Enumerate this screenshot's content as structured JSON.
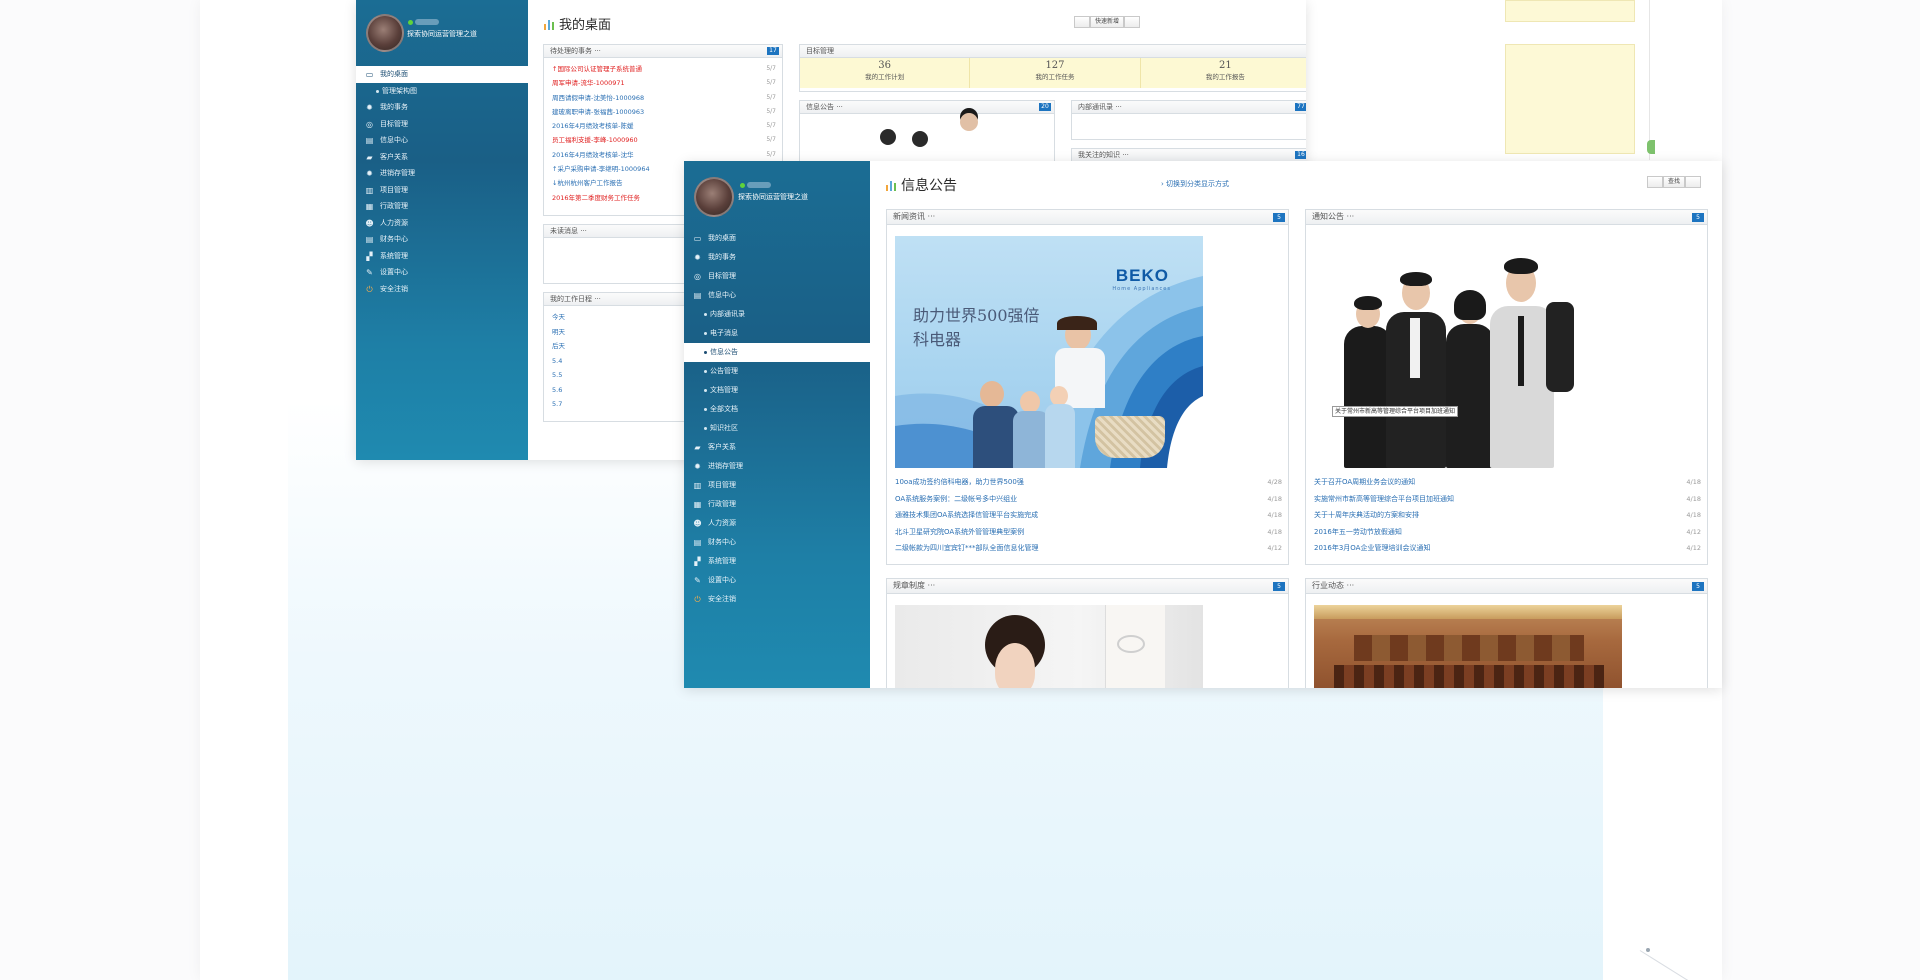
{
  "back_window": {
    "company": "探索协同运营管理之道",
    "title": "我的桌面",
    "buttons": [
      "",
      "快速新增",
      ""
    ],
    "nav": [
      {
        "label": "我的桌面",
        "icon": "monitor-icon",
        "glyph": "▭",
        "active": true
      },
      {
        "label": "管理架构图",
        "sub": true
      },
      {
        "label": "我的事务",
        "icon": "gear-icon",
        "glyph": "✹"
      },
      {
        "label": "目标管理",
        "icon": "target-icon",
        "glyph": "◎"
      },
      {
        "label": "信息中心",
        "icon": "info-icon",
        "glyph": "▤"
      },
      {
        "label": "客户关系",
        "icon": "folder-icon",
        "glyph": "▰"
      },
      {
        "label": "进销存管理",
        "icon": "gear-icon",
        "glyph": "✹"
      },
      {
        "label": "项目管理",
        "icon": "project-icon",
        "glyph": "▥"
      },
      {
        "label": "行政管理",
        "icon": "admin-icon",
        "glyph": "▦"
      },
      {
        "label": "人力资源",
        "icon": "people-icon",
        "glyph": "☻"
      },
      {
        "label": "财务中心",
        "icon": "finance-icon",
        "glyph": "▤"
      },
      {
        "label": "系统管理",
        "icon": "system-icon",
        "glyph": "▞"
      },
      {
        "label": "设置中心",
        "icon": "wrench-icon",
        "glyph": "✎"
      },
      {
        "label": "安全注销",
        "icon": "power-icon",
        "glyph": "⏻"
      }
    ],
    "todo": {
      "header": "待处理的事务 ···",
      "count": "17",
      "items": [
        {
          "text": "↑国际公司认证管理子系统普通",
          "red": true,
          "date": "5/7"
        },
        {
          "text": "周军申请-流华-1000971",
          "red": true,
          "date": "5/7"
        },
        {
          "text": "周西请假申请-沈美怡-1000968",
          "red": false,
          "date": "5/7"
        },
        {
          "text": "建玻离职申请-张福茜-1000963",
          "red": false,
          "date": "5/7"
        },
        {
          "text": "2016年4月绩效考核单-陈媛",
          "red": false,
          "date": "5/7"
        },
        {
          "text": "员工福利支援-李峰-1000960",
          "red": true,
          "date": "5/7"
        },
        {
          "text": "2016年4月绩效考核单-沈华",
          "red": false,
          "date": "5/7"
        },
        {
          "text": "↑采户采购申请-李继明-1000964",
          "red": false,
          "date": "5/7"
        },
        {
          "text": "↓杭州杭州客户工作报告",
          "red": false,
          "date": "5/7"
        },
        {
          "text": "2016年第二季度财务工作任务",
          "red": true,
          "date": "5/7"
        }
      ]
    },
    "unread": {
      "header": "未读消息 ···"
    },
    "schedule": {
      "header": "我的工作日程 ···",
      "days": [
        "今天",
        "明天",
        "后天",
        "5.4",
        "5.5",
        "5.6",
        "5.7"
      ]
    },
    "goals": {
      "header": "目标管理",
      "stats": [
        {
          "num": "36",
          "label": "我的工作计划"
        },
        {
          "num": "127",
          "label": "我的工作任务"
        },
        {
          "num": "21",
          "label": "我的工作报告"
        }
      ]
    },
    "info": {
      "header": "信息公告 ···",
      "count": "20"
    },
    "contacts": {
      "header": "内部通讯录 ···",
      "count": "77"
    },
    "knowledge": {
      "header": "我关注的知识 ···",
      "count": "16"
    }
  },
  "front_window": {
    "company": "探索协同运营管理之道",
    "title": "信息公告",
    "switch_link": "› 切换到分类显示方式",
    "buttons": [
      "",
      "查找",
      ""
    ],
    "nav": [
      {
        "label": "我的桌面",
        "icon": "monitor-icon",
        "glyph": "▭"
      },
      {
        "label": "我的事务",
        "icon": "gear-icon",
        "glyph": "✹"
      },
      {
        "label": "目标管理",
        "icon": "target-icon",
        "glyph": "◎"
      },
      {
        "label": "信息中心",
        "icon": "info-icon",
        "glyph": "▤"
      },
      {
        "label": "内部通讯录",
        "sub": true
      },
      {
        "label": "电子消息",
        "sub": true
      },
      {
        "label": "信息公告",
        "sub": true,
        "active": true
      },
      {
        "label": "公告管理",
        "sub": true
      },
      {
        "label": "文档管理",
        "sub": true
      },
      {
        "label": "全部文档",
        "sub": true
      },
      {
        "label": "知识社区",
        "sub": true
      },
      {
        "label": "客户关系",
        "icon": "folder-icon",
        "glyph": "▰"
      },
      {
        "label": "进销存管理",
        "icon": "gear-icon",
        "glyph": "✹"
      },
      {
        "label": "项目管理",
        "icon": "project-icon",
        "glyph": "▥"
      },
      {
        "label": "行政管理",
        "icon": "admin-icon",
        "glyph": "▦"
      },
      {
        "label": "人力资源",
        "icon": "people-icon",
        "glyph": "☻"
      },
      {
        "label": "财务中心",
        "icon": "finance-icon",
        "glyph": "▤"
      },
      {
        "label": "系统管理",
        "icon": "system-icon",
        "glyph": "▞"
      },
      {
        "label": "设置中心",
        "icon": "wrench-icon",
        "glyph": "✎"
      },
      {
        "label": "安全注销",
        "icon": "power-icon",
        "glyph": "⏻"
      }
    ],
    "news": {
      "header": "新闻资讯 ···",
      "count": "5",
      "image": {
        "brand": "BEKO",
        "brand_sub": "Home Appliances",
        "slogan": "助力世界500强倍科电器"
      },
      "items": [
        {
          "text": "10oa成功签约倍科电器，助力世界500强",
          "date": "4/28"
        },
        {
          "text": "OA系统服务案例：二级帐号多中兴组业",
          "date": "4/18"
        },
        {
          "text": "通雅技术集团OA系统选择信管理平台实施完成",
          "date": "4/18"
        },
        {
          "text": "北斗卫星研究院OA系统外管管理典型案例",
          "date": "4/18"
        },
        {
          "text": "二级帐款为四川宜宾钉***部队全面信息化管理",
          "date": "4/12"
        }
      ]
    },
    "notice": {
      "header": "通知公告 ···",
      "count": "5",
      "image_caption": "关于常州市新高等管理综合平台项目加班通知",
      "items": [
        {
          "text": "关于召开OA周期业务会议的通知",
          "date": "4/18"
        },
        {
          "text": "实施常州市新高等管理综合平台项目加班通知",
          "date": "4/18"
        },
        {
          "text": "关于十周年庆典活动的方案和安排",
          "date": "4/18"
        },
        {
          "text": "2016年五一劳动节放假通知",
          "date": "4/12"
        },
        {
          "text": "2016年3月OA企业管理培训会议通知",
          "date": "4/12"
        }
      ]
    },
    "rules": {
      "header": "规章制度 ···",
      "count": "5"
    },
    "industry": {
      "header": "行业动态 ···",
      "count": "5"
    }
  }
}
